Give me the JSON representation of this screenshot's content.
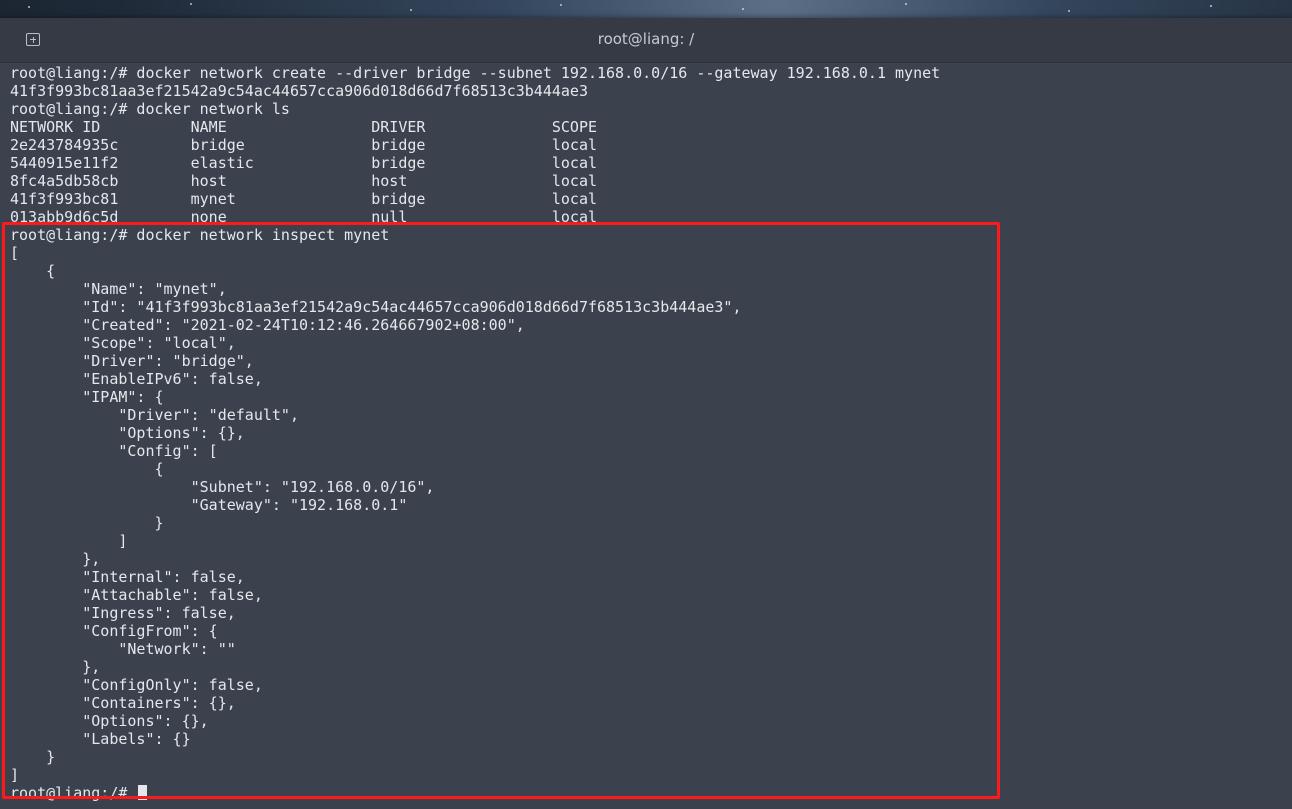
{
  "window": {
    "title": "root@liang: /",
    "new_tab_icon": "new-tab-icon"
  },
  "terminal": {
    "lines": [
      "root@liang:/# docker network create --driver bridge --subnet 192.168.0.0/16 --gateway 192.168.0.1 mynet",
      "41f3f993bc81aa3ef21542a9c54ac44657cca906d018d66d7f68513c3b444ae3",
      "root@liang:/# docker network ls",
      "NETWORK ID          NAME                DRIVER              SCOPE",
      "2e243784935c        bridge              bridge              local",
      "5440915e11f2        elastic             bridge              local",
      "8fc4a5db58cb        host                host                local",
      "41f3f993bc81        mynet               bridge              local",
      "013abb9d6c5d        none                null                local",
      "root@liang:/# docker network inspect mynet",
      "[",
      "    {",
      "        \"Name\": \"mynet\",",
      "        \"Id\": \"41f3f993bc81aa3ef21542a9c54ac44657cca906d018d66d7f68513c3b444ae3\",",
      "        \"Created\": \"2021-02-24T10:12:46.264667902+08:00\",",
      "        \"Scope\": \"local\",",
      "        \"Driver\": \"bridge\",",
      "        \"EnableIPv6\": false,",
      "        \"IPAM\": {",
      "            \"Driver\": \"default\",",
      "            \"Options\": {},",
      "            \"Config\": [",
      "                {",
      "                    \"Subnet\": \"192.168.0.0/16\",",
      "                    \"Gateway\": \"192.168.0.1\"",
      "                }",
      "            ]",
      "        },",
      "        \"Internal\": false,",
      "        \"Attachable\": false,",
      "        \"Ingress\": false,",
      "        \"ConfigFrom\": {",
      "            \"Network\": \"\"",
      "        },",
      "        \"ConfigOnly\": false,",
      "        \"Containers\": {},",
      "        \"Options\": {},",
      "        \"Labels\": {}",
      "    }",
      "]"
    ],
    "prompt": "root@liang:/# ",
    "highlight_color": "#ff1a1a"
  }
}
